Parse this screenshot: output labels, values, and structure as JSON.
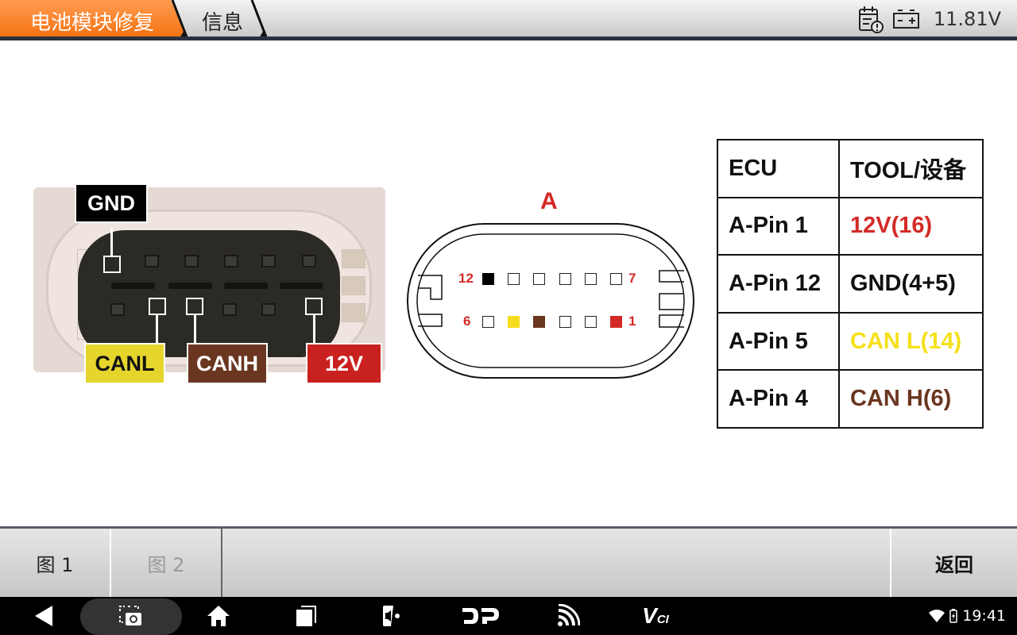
{
  "header": {
    "breadcrumb": [
      "电池模块修复",
      "信息"
    ],
    "icons": [
      "calendar-alert-icon",
      "battery-icon"
    ],
    "voltage": "11.81V",
    "accent_color": "#f47312"
  },
  "photo": {
    "labels": {
      "gnd": "GND",
      "canl": "CANL",
      "canh": "CANH",
      "v12": "12V"
    },
    "colors": {
      "gnd": "#000000",
      "canl": "#e6d52c",
      "canh": "#6b3620",
      "v12": "#c9211f"
    }
  },
  "diagram": {
    "title": "A",
    "top_row_labels": [
      "12",
      "7"
    ],
    "bottom_row_labels": [
      "6",
      "1"
    ],
    "top_row_pins": [
      {
        "pin": 12,
        "color": "#000000"
      },
      {
        "pin": 11,
        "color": "#ffffff"
      },
      {
        "pin": 10,
        "color": "#ffffff"
      },
      {
        "pin": 9,
        "color": "#ffffff"
      },
      {
        "pin": 8,
        "color": "#ffffff"
      },
      {
        "pin": 7,
        "color": "#ffffff"
      }
    ],
    "bottom_row_pins": [
      {
        "pin": 6,
        "color": "#ffffff"
      },
      {
        "pin": 5,
        "color": "#f5dd1e"
      },
      {
        "pin": 4,
        "color": "#6b3620"
      },
      {
        "pin": 3,
        "color": "#ffffff"
      },
      {
        "pin": 2,
        "color": "#ffffff"
      },
      {
        "pin": 1,
        "color": "#d42a26"
      }
    ]
  },
  "table": {
    "headers": [
      "ECU",
      "TOOL/设备"
    ],
    "rows": [
      {
        "ecu": "A-Pin 1",
        "tool": "12V(16)",
        "color": "#d42a26"
      },
      {
        "ecu": "A-Pin 12",
        "tool": "GND(4+5)",
        "color": "#111111"
      },
      {
        "ecu": "A-Pin 5",
        "tool": "CAN L(14)",
        "color": "#f5e01a"
      },
      {
        "ecu": "A-Pin 4",
        "tool": "CAN H(6)",
        "color": "#6b3620"
      }
    ]
  },
  "toolbar": {
    "fig1": "图 1",
    "fig2": "图 2",
    "back": "返回"
  },
  "navbar": {
    "icons": [
      "back-icon",
      "screenshot-icon",
      "home-icon",
      "recent-apps-icon",
      "display-settings-icon",
      "dp-icon",
      "signal-icon",
      "vci-icon"
    ],
    "dp_label": "DP",
    "vci_label": "V",
    "vci_sub": "CI",
    "time": "19:41"
  }
}
